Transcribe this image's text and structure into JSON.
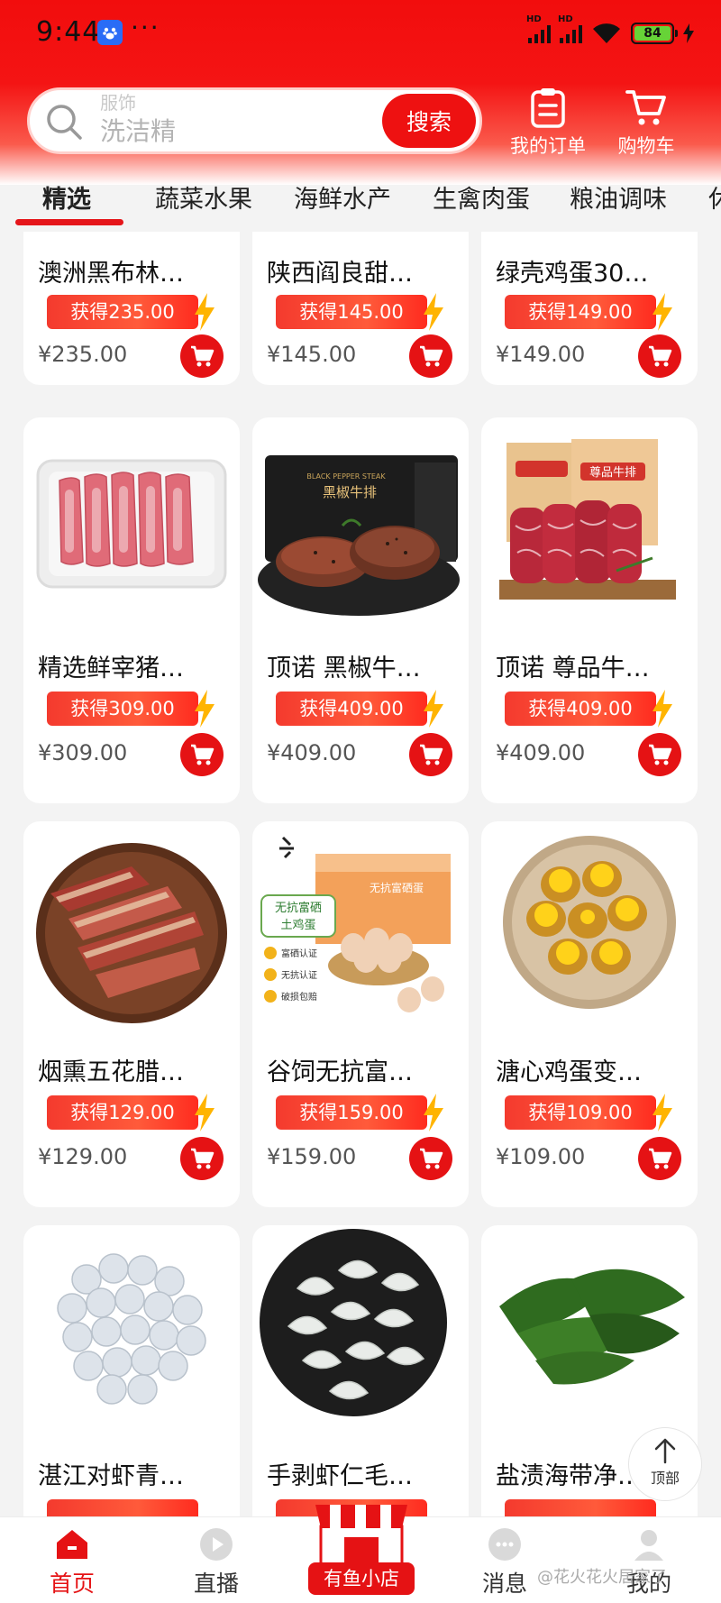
{
  "status_bar": {
    "time": "9:44",
    "dots": "···",
    "battery": "84"
  },
  "search": {
    "ghost_text": "服饰",
    "placeholder": "洗洁精",
    "button_label": "搜索"
  },
  "header_actions": {
    "orders_label": "我的订单",
    "cart_label": "购物车"
  },
  "tabs": [
    "精选",
    "蔬菜水果",
    "海鲜水产",
    "生禽肉蛋",
    "粮油调味",
    "休"
  ],
  "products": [
    {
      "title": "澳洲黑布林…",
      "earn": "获得235.00",
      "price": "¥235.00"
    },
    {
      "title": "陕西阎良甜…",
      "earn": "获得145.00",
      "price": "¥145.00"
    },
    {
      "title": "绿壳鸡蛋30…",
      "earn": "获得149.00",
      "price": "¥149.00"
    },
    {
      "title": "精选鲜宰猪…",
      "earn": "获得309.00",
      "price": "¥309.00"
    },
    {
      "title": "顶诺 黑椒牛…",
      "earn": "获得409.00",
      "price": "¥409.00"
    },
    {
      "title": "顶诺 尊品牛…",
      "earn": "获得409.00",
      "price": "¥409.00"
    },
    {
      "title": "烟熏五花腊…",
      "earn": "获得129.00",
      "price": "¥129.00"
    },
    {
      "title": "谷饲无抗富…",
      "earn": "获得159.00",
      "price": "¥159.00"
    },
    {
      "title": "溏心鸡蛋变…",
      "earn": "获得109.00",
      "price": "¥109.00"
    },
    {
      "title": "湛江对虾青…",
      "earn": "",
      "price": ""
    },
    {
      "title": "手剥虾仁毛…",
      "earn": "",
      "price": ""
    },
    {
      "title": "盐渍海带净…",
      "earn": "",
      "price": ""
    }
  ],
  "image_text": {
    "steak_box": "黑椒牛排",
    "steak_box_en": "BLACK PEPPER STEAK",
    "premium_box": "尊品牛排",
    "egg_badge_line1": "无抗富硒",
    "egg_badge_line2": "土鸡蛋",
    "egg_box": "无抗富硒蛋",
    "egg_points": [
      "富硒认证",
      "无抗认证",
      "破损包赔"
    ]
  },
  "back_to_top": "顶部",
  "bottom_nav": {
    "home": "首页",
    "live": "直播",
    "shop": "有鱼小店",
    "messages": "消息",
    "mine": "我的"
  },
  "watermark": "@花火花火居家了",
  "colors": {
    "primary_red": "#e51214",
    "header_red": "#f20d0d",
    "bolt_yellow": "#ffb400"
  }
}
